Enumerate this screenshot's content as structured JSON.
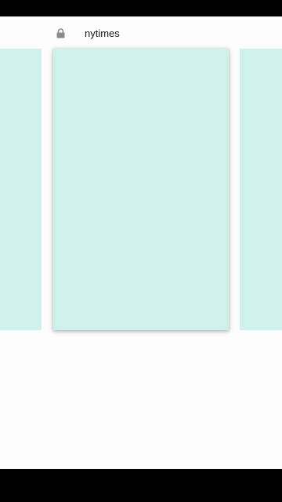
{
  "header": {
    "site_name": "nytimes",
    "secure_icon": "lock-icon"
  },
  "colors": {
    "card_background": "#cff1ec",
    "system_bars": "#000000",
    "page_background": "#fdfdfd",
    "icon": "#8a8a8a"
  }
}
